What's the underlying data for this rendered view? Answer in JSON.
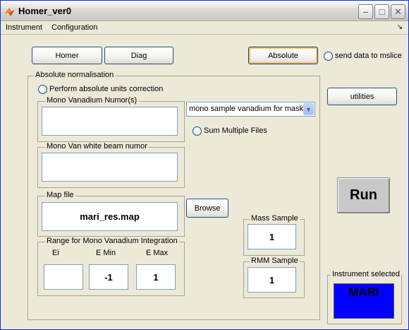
{
  "window": {
    "title": "Homer_ver0",
    "controls": {
      "minimize": "–",
      "maximize": "□",
      "close": "✕"
    }
  },
  "menu": {
    "items": [
      "Instrument",
      "Configuration"
    ],
    "dock_symbol": "↘"
  },
  "top_buttons": {
    "homer": "Homer",
    "diag": "Diag",
    "absolute": "Absolute"
  },
  "send_data_label": "send data to mslice",
  "utilities_label": "utilities",
  "absolute_panel": {
    "title": "Absolute normalisation",
    "perform_label": "Perform absolute units correction",
    "mono_vanadium": {
      "title": "Mono Vanadium Numor(s)",
      "value": ""
    },
    "mask_select": {
      "selected": "mono sample vanadium for mask"
    },
    "sum_multiple_label": "Sum Multiple Files",
    "white_beam": {
      "title": "Mono Van white beam numor",
      "value": ""
    },
    "map_file": {
      "title": "Map file",
      "value": "mari_res.map"
    },
    "browse_label": "Browse",
    "range": {
      "title": "Range for Mono Vanadium Integration",
      "ei_label": "Ei",
      "emin_label": "E Min",
      "emax_label": "E Max",
      "ei_value": "",
      "emin_value": "-1",
      "emax_value": "1"
    },
    "mass_sample": {
      "title": "Mass Sample",
      "value": "1"
    },
    "rmm_sample": {
      "title": "RMM Sample",
      "value": "1"
    }
  },
  "run_label": "Run",
  "instrument_selected": {
    "title": "Instrument selected",
    "value": "MARI"
  },
  "colors": {
    "instrument_box": "#0000ff",
    "window_bg": "#ece9d8",
    "focus_ring": "#f5c15c"
  },
  "icons": {
    "app": "matlab-logo-icon",
    "dropdown": "chevron-down-icon",
    "dock": "dock-arrow-icon"
  }
}
